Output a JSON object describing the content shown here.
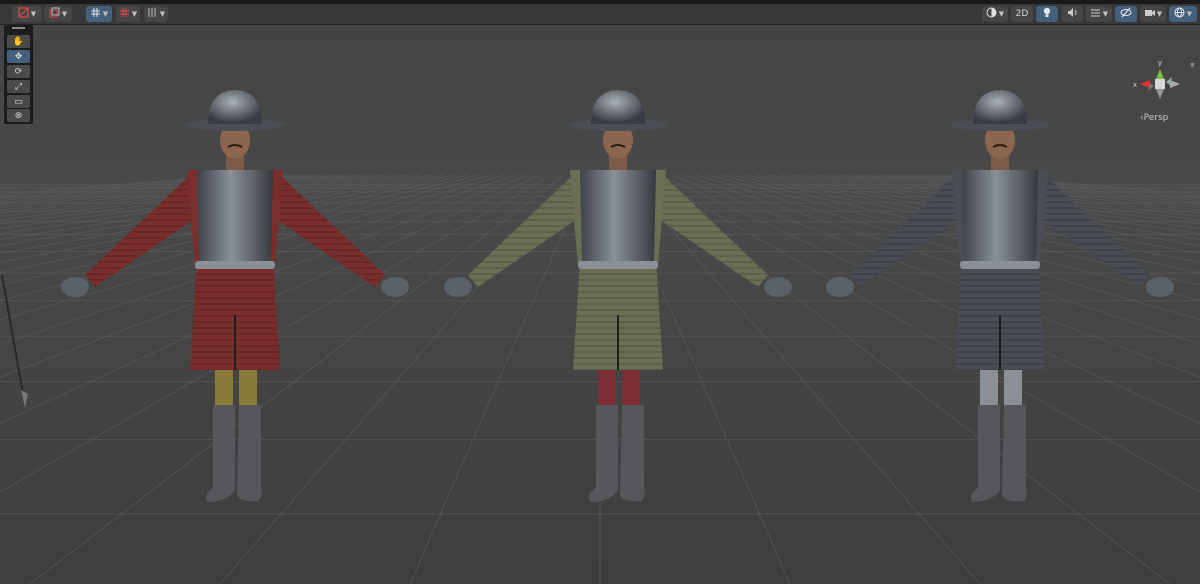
{
  "toolbar": {
    "left_buttons": [
      {
        "name": "draw-mode",
        "icon": "shaded-cube-icon"
      },
      {
        "name": "render-paths",
        "icon": "cube-stack-icon"
      },
      {
        "name": "grid-snap",
        "icon": "grid-move-icon"
      },
      {
        "name": "increment-snap",
        "icon": "grid-icon"
      },
      {
        "name": "overlays",
        "icon": "bars-icon"
      }
    ],
    "right_buttons": [
      {
        "name": "shading-mode",
        "icon": "sphere-icon"
      },
      {
        "name": "mode-2d",
        "label": "2D"
      },
      {
        "name": "lighting",
        "icon": "lightbulb-icon"
      },
      {
        "name": "audio",
        "icon": "speaker-icon"
      },
      {
        "name": "effects",
        "icon": "effects-icon"
      },
      {
        "name": "hidden-objects",
        "icon": "eye-slash-icon"
      },
      {
        "name": "camera",
        "icon": "camera-icon"
      },
      {
        "name": "gizmos",
        "icon": "globe-icon"
      }
    ]
  },
  "tools": [
    {
      "name": "hand-tool",
      "icon": "hand-icon"
    },
    {
      "name": "move-tool",
      "icon": "move-arrows-icon",
      "active": true
    },
    {
      "name": "rotate-tool",
      "icon": "rotate-icon"
    },
    {
      "name": "scale-tool",
      "icon": "scale-icon"
    },
    {
      "name": "rect-tool",
      "icon": "rect-icon"
    },
    {
      "name": "transform-tool",
      "icon": "transform-icon"
    }
  ],
  "gizmo": {
    "x_label": "x",
    "y_label": "y",
    "persp_label": "Persp"
  },
  "colors": {
    "background": "#464646",
    "grid": "#666666",
    "gambeson_red": "#7a2e2e",
    "gambeson_green": "#6a6e55",
    "gambeson_gray": "#4a4d54",
    "armor": "#5a6068",
    "accent": "#46607c"
  }
}
